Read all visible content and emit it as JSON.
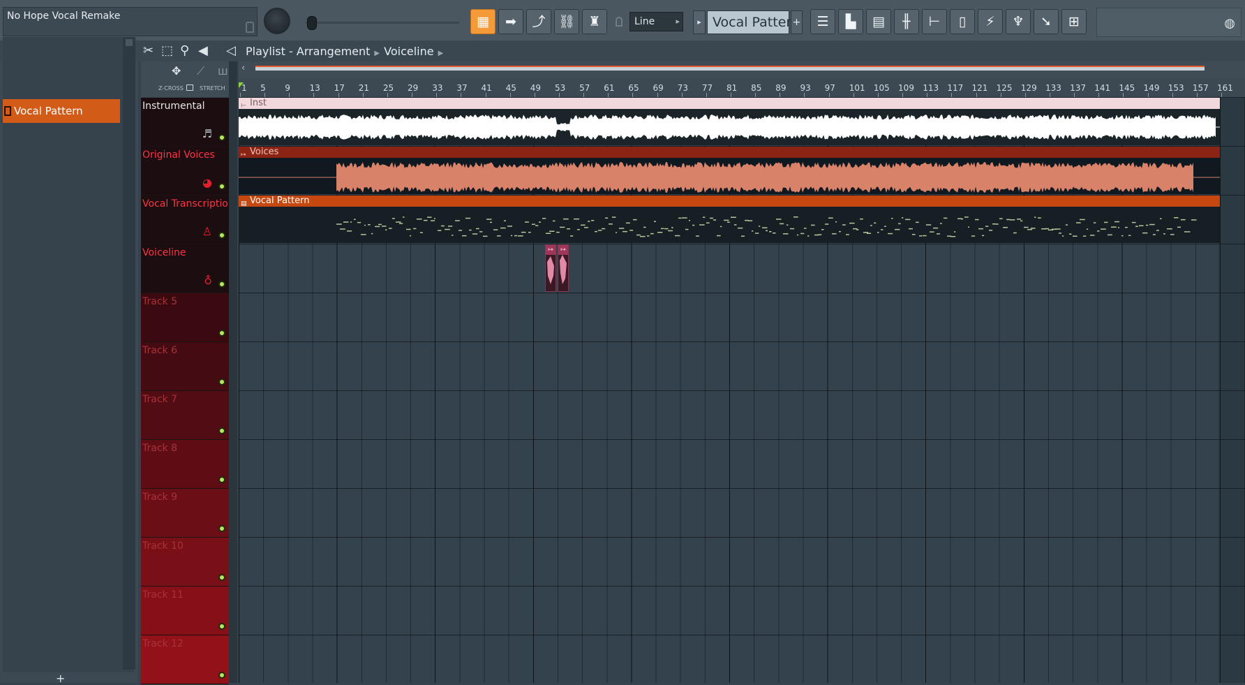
{
  "project": {
    "title": "No Hope Vocal Remake"
  },
  "toolbar": {
    "snap_mode": "Line",
    "pattern_selected": "Vocal Pattern",
    "pattern_add": "+",
    "buttons": [
      "playlist-icon",
      "arrow-icon",
      "tilde-icon",
      "link-icon",
      "stamp-icon",
      "playlist-view-icon",
      "step-icon",
      "channel-rack-icon",
      "mixer-icon",
      "browser-icon",
      "files-icon",
      "plugin-icon",
      "tools-icon",
      "export-icon",
      "cart-icon"
    ]
  },
  "playlist": {
    "breadcrumb": [
      "Playlist - Arrangement",
      "Voiceline"
    ]
  },
  "picker": {
    "selected_pattern": "Vocal Pattern",
    "add_label": "+"
  },
  "timeline": {
    "labels_z": "Z-CROSS",
    "labels_stretch": "STRETCH",
    "bars": [
      "1",
      "5",
      "9",
      "13",
      "17",
      "21",
      "25",
      "29",
      "33",
      "37",
      "41",
      "45",
      "49",
      "53",
      "57",
      "61",
      "65",
      "69",
      "73",
      "77",
      "81",
      "85",
      "89",
      "93",
      "97",
      "101",
      "105",
      "109",
      "113",
      "117",
      "121",
      "125",
      "129",
      "133",
      "137",
      "141",
      "145",
      "149",
      "153",
      "157",
      "161"
    ]
  },
  "tracks": [
    {
      "name": "Instrumental",
      "icon": "guitar-icon",
      "color": "#e7e7e7"
    },
    {
      "name": "Original Voices",
      "icon": "lips-icon",
      "color": "#ff3344"
    },
    {
      "name": "Vocal Transcription",
      "icon": "person-icon",
      "color": "#ff3344"
    },
    {
      "name": "Voiceline",
      "icon": "microphone-icon",
      "color": "#ff3344"
    },
    {
      "name": "Track 5",
      "color": "#a8323b"
    },
    {
      "name": "Track 6",
      "color": "#a8323b"
    },
    {
      "name": "Track 7",
      "color": "#a8323b"
    },
    {
      "name": "Track 8",
      "color": "#a8323b"
    },
    {
      "name": "Track 9",
      "color": "#a8323b"
    },
    {
      "name": "Track 10",
      "color": "#a8323b"
    },
    {
      "name": "Track 11",
      "color": "#a8323b"
    },
    {
      "name": "Track 12",
      "color": "#a8323b"
    }
  ],
  "clips": {
    "inst": "Inst",
    "voices": "Voices",
    "vocal_pattern": "Vocal Pattern"
  },
  "colors": {
    "accent_orange": "#d35b18",
    "active_tool": "#f49a39",
    "voices_clip": "#9e2a1c",
    "voices_wave": "#d9826a",
    "voiceline_clip": "#e08aa8"
  }
}
